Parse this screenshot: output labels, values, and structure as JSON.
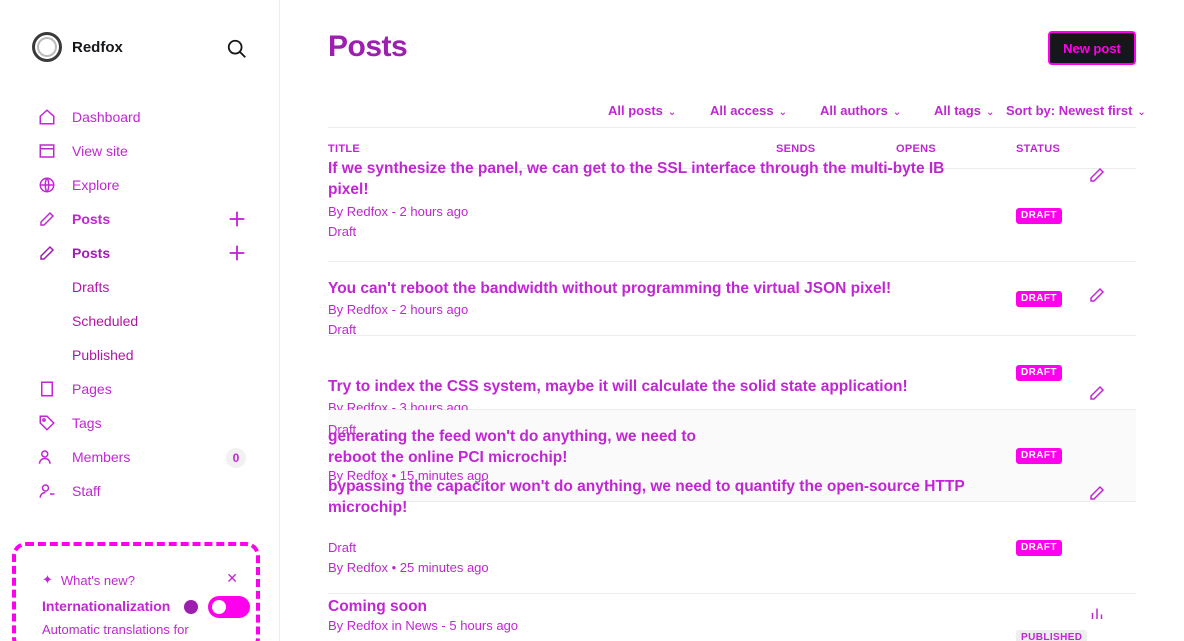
{
  "brand": {
    "name": "Redfox"
  },
  "sidebar": {
    "items": [
      {
        "label": "Dashboard"
      },
      {
        "label": "View site"
      },
      {
        "label": "Explore"
      },
      {
        "label": "Posts"
      },
      {
        "label": "Posts"
      }
    ],
    "subitems": [
      {
        "label": "Drafts"
      },
      {
        "label": "Scheduled"
      },
      {
        "label": "Published"
      }
    ],
    "lower": [
      {
        "label": "Pages"
      },
      {
        "label": "Tags"
      },
      {
        "label": "Members",
        "count": "0"
      },
      {
        "label": "Staff"
      }
    ]
  },
  "whats_new": {
    "heading": "What's new?",
    "title": "Internationalization",
    "description": "Automatic translations for"
  },
  "page": {
    "title": "Posts",
    "new_post": "New post"
  },
  "filters": {
    "posts": "All posts",
    "access": "All access",
    "authors": "All authors",
    "tags": "All tags",
    "sort": "Sort by: Newest first"
  },
  "table": {
    "headers": {
      "title": "TITLE",
      "sends": "SENDS",
      "opens": "OPENS",
      "status": "STATUS"
    },
    "rows": [
      {
        "title": "If we synthesize the panel, we can get to the SSL interface through the multi-byte IB pixel!",
        "meta": "By Redfox - 2 hours ago",
        "status": "Draft",
        "badge": "DRAFT"
      },
      {
        "title": "You can't reboot the bandwidth without programming the virtual JSON pixel!",
        "meta": "By Redfox - 2 hours ago",
        "status": "Draft",
        "badge": "DRAFT"
      },
      {
        "title": "Try to index the CSS system, maybe it will calculate the solid state application!",
        "meta": "By Redfox - 3 hours ago",
        "status": "Draft",
        "badge": "DRAFT"
      },
      {
        "title": "generating the feed won't do anything, we need to reboot the online PCI microchip!",
        "meta": "By Redfox • 15 minutes ago",
        "status": "",
        "badge": "DRAFT"
      },
      {
        "title": "bypassing the capacitor won't do anything, we need to quantify the open-source HTTP microchip!",
        "meta": "By Redfox • 25 minutes ago",
        "status": "Draft",
        "badge": "DRAFT"
      },
      {
        "title": "Coming soon",
        "meta": "By Redfox in News - 5 hours ago",
        "status": "",
        "badge": "PUBLISHED"
      }
    ]
  }
}
